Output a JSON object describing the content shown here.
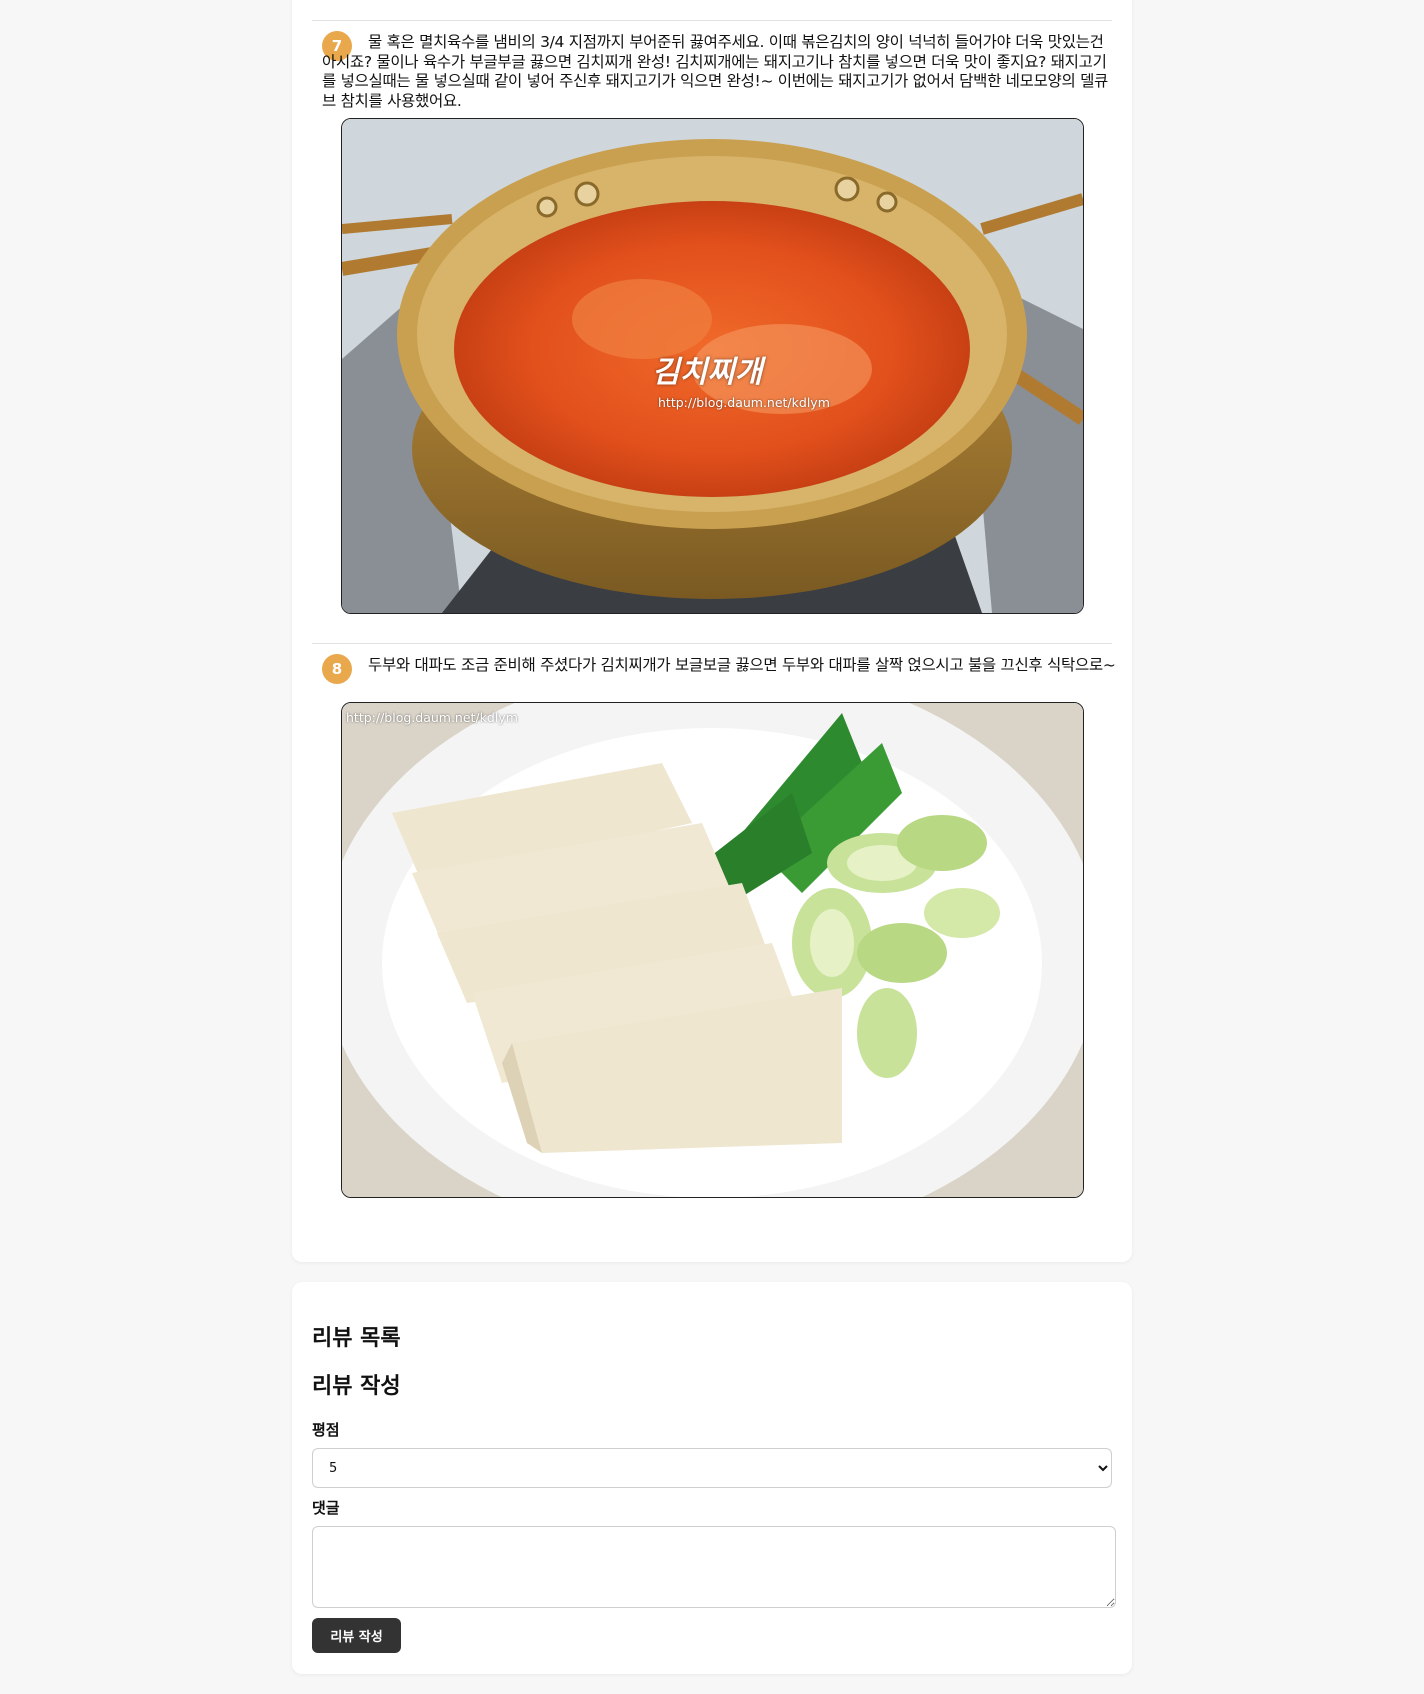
{
  "steps": [
    {
      "number": "7",
      "text": "물 혹은 멸치육수를 냄비의 3/4 지점까지 부어준뒤 끓여주세요. 이때 볶은김치의 양이 넉넉히 들어가야 더욱 맛있는건 아시죠? 물이나 육수가 부글부글 끓으면 김치찌개 완성! 김치찌개에는 돼지고기나 참치를 넣으면 더욱 맛이 좋지요? 돼지고기를 넣으실때는 물 넣으실때 같이 넣어 주신후 돼지고기가 익으면 완성!~ 이번에는 돼지고기가 없어서 담백한 네모모양의 델큐브 참치를 사용했어요.",
      "image": {
        "title_overlay": "김치찌개",
        "watermark": "http://blog.daum.net/kdlym"
      }
    },
    {
      "number": "8",
      "text": "두부와 대파도 조금 준비해 주셨다가 김치찌개가 보글보글 끓으면 두부와 대파를 살짝 얹으시고 불을 끄신후 식탁으로~",
      "image": {
        "watermark": "http://blog.daum.net/kdlym"
      }
    }
  ],
  "reviews": {
    "list_title": "리뷰 목록",
    "form_title": "리뷰 작성",
    "rating_label": "평점",
    "rating_value": "5",
    "comment_label": "댓글",
    "comment_value": "",
    "submit_label": "리뷰 작성"
  },
  "colors": {
    "step_badge": "#e9a84c",
    "button": "#333333"
  }
}
